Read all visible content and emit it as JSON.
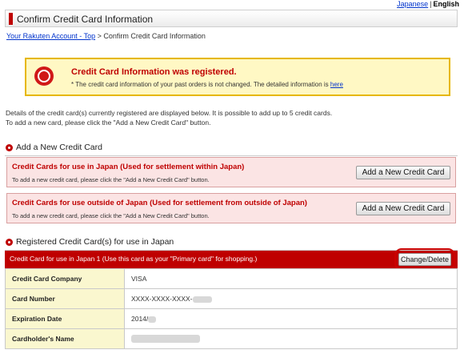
{
  "lang": {
    "japanese": "Japanese",
    "separator": "|",
    "english": "English"
  },
  "header": {
    "title": "Confirm Credit Card Information"
  },
  "breadcrumb": {
    "link": "Your Rakuten Account - Top",
    "sep": ">",
    "current": "Confirm Credit Card Information"
  },
  "notice": {
    "title": "Credit Card Information was registered.",
    "subtitle": "* The credit card information of your past orders is not changed. The detailed information is",
    "link": "here"
  },
  "intro": {
    "line1": "Details of the credit card(s) currently registered are displayed below. It is possible to add up to 5 credit cards.",
    "line2": "To add a new card, please click the \"Add a New Credit Card\" button."
  },
  "add_section": {
    "title": "Add a New Credit Card"
  },
  "add_japan": {
    "title": "Credit Cards for use in Japan (Used for settlement within Japan)",
    "subtitle": "To add a new credit card, please click the \"Add a New Credit Card\" button.",
    "button": "Add a New Credit Card"
  },
  "add_outside": {
    "title": "Credit Cards for use outside of Japan (Used for settlement from outside of Japan)",
    "subtitle": "To add a new credit card, please click the \"Add a New Credit Card\" button.",
    "button": "Add a New Credit Card"
  },
  "registered_section": {
    "title": "Registered Credit Card(s) for use in Japan"
  },
  "card1": {
    "header": "Credit Card for use in Japan 1 (Use this card as your \"Primary card\" for shopping.)",
    "button": "Change/Delete",
    "rows": [
      {
        "label": "Credit Card Company",
        "value": "VISA"
      },
      {
        "label": "Card Number",
        "value": "XXXX-XXXX-XXXX-"
      },
      {
        "label": "Expiration Date",
        "value": "2014/"
      },
      {
        "label": "Cardholder's Name",
        "value": ""
      }
    ]
  },
  "colors": {
    "accent": "#bf0000",
    "notice_bg": "#fff8c4",
    "add_box_bg": "#fbe4e4",
    "label_bg": "#faf7cf"
  }
}
